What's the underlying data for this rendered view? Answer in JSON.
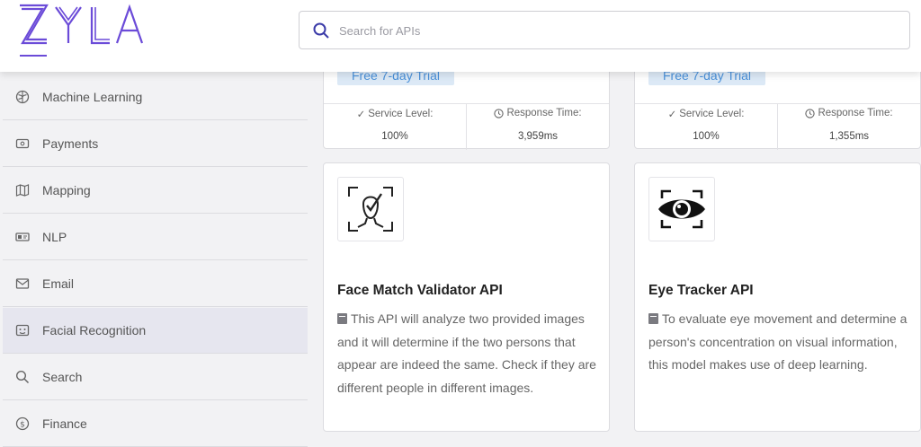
{
  "brand": {
    "logo_text": "ZYLA",
    "accent": "#6b4bd8"
  },
  "search": {
    "placeholder": "Search for APIs",
    "value": ""
  },
  "sidebar": {
    "items": [
      {
        "label": "Machine Learning",
        "icon": "brain-icon",
        "active": false
      },
      {
        "label": "Payments",
        "icon": "wallet-icon",
        "active": false
      },
      {
        "label": "Mapping",
        "icon": "map-icon",
        "active": false
      },
      {
        "label": "NLP",
        "icon": "id-card-icon",
        "active": false
      },
      {
        "label": "Email",
        "icon": "envelope-icon",
        "active": false
      },
      {
        "label": "Facial Recognition",
        "icon": "face-id-icon",
        "active": true
      },
      {
        "label": "Search",
        "icon": "search-icon",
        "active": false
      },
      {
        "label": "Finance",
        "icon": "dollar-icon",
        "active": false
      }
    ]
  },
  "top_cards": [
    {
      "badge": "Free 7-day Trial",
      "service_label": "Service Level:",
      "service_value": "100%",
      "response_label": "Response Time:",
      "response_value": "3,959ms"
    },
    {
      "badge": "Free 7-day Trial",
      "service_label": "Service Level:",
      "service_value": "100%",
      "response_label": "Response Time:",
      "response_value": "1,355ms"
    }
  ],
  "api_cards": [
    {
      "title": "Face Match Validator API",
      "icon": "face-check-icon",
      "description": "This API will analyze two provided images and it will determine if the two persons that appear are indeed the same. Check if they are different people in different images."
    },
    {
      "title": "Eye Tracker API",
      "icon": "eye-scan-icon",
      "description": "To evaluate eye movement and determine a person's concentration on visual information, this model makes use of deep learning."
    }
  ]
}
